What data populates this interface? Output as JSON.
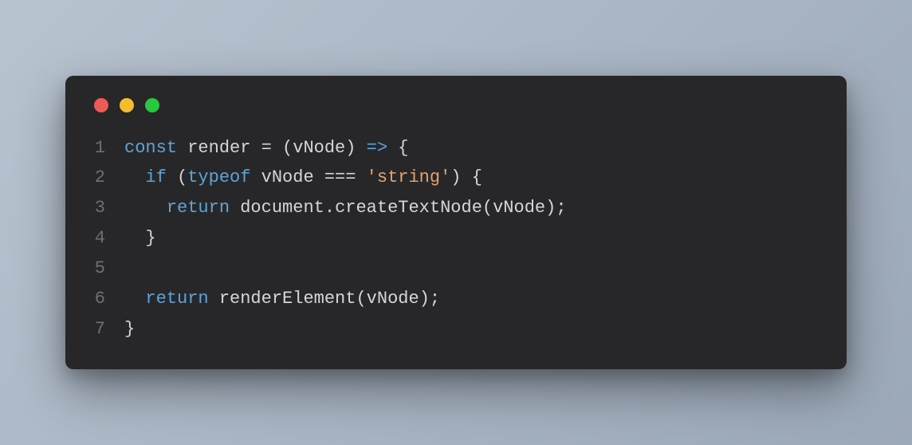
{
  "window": {
    "traffic_lights": {
      "red": "#ee5b56",
      "yellow": "#f6bc2f",
      "green": "#28c840"
    }
  },
  "code": {
    "line_numbers": [
      "1",
      "2",
      "3",
      "4",
      "5",
      "6",
      "7"
    ],
    "lines": [
      {
        "indent": "",
        "tokens": [
          {
            "t": "const ",
            "c": "tok-kw"
          },
          {
            "t": "render ",
            "c": "tok-fn"
          },
          {
            "t": "= ",
            "c": "tok-op"
          },
          {
            "t": "(",
            "c": "tok-punc"
          },
          {
            "t": "vNode",
            "c": "tok-id"
          },
          {
            "t": ") ",
            "c": "tok-punc"
          },
          {
            "t": "=>",
            "c": "tok-arrow"
          },
          {
            "t": " {",
            "c": "tok-brace"
          }
        ]
      },
      {
        "indent": "  ",
        "tokens": [
          {
            "t": "if ",
            "c": "tok-kw"
          },
          {
            "t": "(",
            "c": "tok-punc"
          },
          {
            "t": "typeof ",
            "c": "tok-kw"
          },
          {
            "t": "vNode ",
            "c": "tok-id"
          },
          {
            "t": "=== ",
            "c": "tok-op"
          },
          {
            "t": "'string'",
            "c": "tok-str"
          },
          {
            "t": ") {",
            "c": "tok-brace"
          }
        ]
      },
      {
        "indent": "    ",
        "tokens": [
          {
            "t": "return ",
            "c": "tok-kw"
          },
          {
            "t": "document",
            "c": "tok-id"
          },
          {
            "t": ".",
            "c": "tok-punc"
          },
          {
            "t": "createTextNode",
            "c": "tok-fn"
          },
          {
            "t": "(",
            "c": "tok-punc"
          },
          {
            "t": "vNode",
            "c": "tok-id"
          },
          {
            "t": ");",
            "c": "tok-punc"
          }
        ]
      },
      {
        "indent": "  ",
        "tokens": [
          {
            "t": "}",
            "c": "tok-brace"
          }
        ]
      },
      {
        "indent": "",
        "tokens": []
      },
      {
        "indent": "  ",
        "tokens": [
          {
            "t": "return ",
            "c": "tok-kw"
          },
          {
            "t": "renderElement",
            "c": "tok-fn"
          },
          {
            "t": "(",
            "c": "tok-punc"
          },
          {
            "t": "vNode",
            "c": "tok-id"
          },
          {
            "t": ");",
            "c": "tok-punc"
          }
        ]
      },
      {
        "indent": "",
        "tokens": [
          {
            "t": "}",
            "c": "tok-brace"
          }
        ]
      }
    ]
  }
}
